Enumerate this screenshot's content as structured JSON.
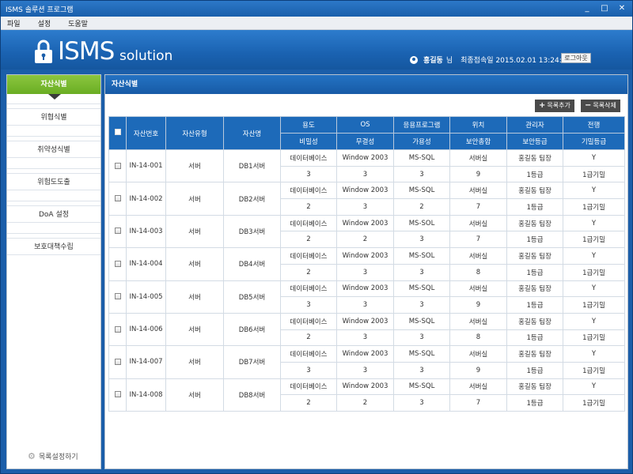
{
  "window": {
    "title": "ISMS 솔루션 프로그램",
    "ctrl_min": "_",
    "ctrl_max": "□",
    "ctrl_close": "✕"
  },
  "menu": [
    "파일",
    "설정",
    "도움말"
  ],
  "header": {
    "logo_main": "ISMS",
    "logo_sub": "solution",
    "user_name": "홍길동",
    "user_suffix": "님",
    "last_login": "최종접속일 2015.02.01 13:24:03",
    "logout": "로그아웃"
  },
  "sidebar": {
    "active": "자산식별",
    "items": [
      "위협식별",
      "취약성식별",
      "위험도도출",
      "DoA 설정",
      "보호대책수립"
    ],
    "settings": "목록설정하기"
  },
  "main": {
    "title": "자산식별",
    "add_button": "목록추가",
    "delete_button": "목록삭제",
    "headers_top": [
      "자산번호",
      "자산유형",
      "자산명",
      "용도",
      "OS",
      "응용프로그램",
      "위치",
      "관리자",
      "전행"
    ],
    "headers_bottom": [
      "비밀성",
      "무결성",
      "가용성",
      "보안총합",
      "보안등급",
      "기밀등급"
    ],
    "rows": [
      {
        "id": "IN-14-001",
        "type": "서버",
        "name": "DB1서버",
        "use": "데이터베이스",
        "os": "Window 2003",
        "app": "MS-SQL",
        "loc": "서버실",
        "mgr": "홍길동 팀장",
        "flag": "Y",
        "conf": "3",
        "integ": "3",
        "avail": "3",
        "total": "9",
        "sec": "1등급",
        "secret": "1급기밀"
      },
      {
        "id": "IN-14-002",
        "type": "서버",
        "name": "DB2서버",
        "use": "데이터베이스",
        "os": "Window 2003",
        "app": "MS-SQL",
        "loc": "서버실",
        "mgr": "홍길동 팀장",
        "flag": "Y",
        "conf": "2",
        "integ": "3",
        "avail": "2",
        "total": "7",
        "sec": "1등급",
        "secret": "1급기밀"
      },
      {
        "id": "IN-14-003",
        "type": "서버",
        "name": "DB3서버",
        "use": "데이터베이스",
        "os": "Window 2003",
        "app": "MS-SOL",
        "loc": "서버실",
        "mgr": "홍길동 팀장",
        "flag": "Y",
        "conf": "2",
        "integ": "2",
        "avail": "3",
        "total": "7",
        "sec": "1등급",
        "secret": "1급기밀"
      },
      {
        "id": "IN-14-004",
        "type": "서버",
        "name": "DB4서버",
        "use": "데이터베이스",
        "os": "Window 2003",
        "app": "MS-SOL",
        "loc": "서버실",
        "mgr": "홍길동 팀장",
        "flag": "Y",
        "conf": "2",
        "integ": "3",
        "avail": "3",
        "total": "8",
        "sec": "1등급",
        "secret": "1급기밀"
      },
      {
        "id": "IN-14-005",
        "type": "서버",
        "name": "DB5서버",
        "use": "데이터베이스",
        "os": "Window 2003",
        "app": "MS-SQL",
        "loc": "서버실",
        "mgr": "홍길동 팀장",
        "flag": "Y",
        "conf": "3",
        "integ": "3",
        "avail": "3",
        "total": "9",
        "sec": "1등급",
        "secret": "1급기밀"
      },
      {
        "id": "IN-14-006",
        "type": "서버",
        "name": "DB6서버",
        "use": "데이터베이스",
        "os": "Window 2003",
        "app": "MS-SQL",
        "loc": "서버실",
        "mgr": "홍길동 팀장",
        "flag": "Y",
        "conf": "2",
        "integ": "3",
        "avail": "3",
        "total": "8",
        "sec": "1등급",
        "secret": "1급기밀"
      },
      {
        "id": "IN-14-007",
        "type": "서버",
        "name": "DB7서버",
        "use": "데이터베이스",
        "os": "Window 2003",
        "app": "MS-SQL",
        "loc": "서버실",
        "mgr": "홍길동 팀장",
        "flag": "Y",
        "conf": "3",
        "integ": "3",
        "avail": "3",
        "total": "9",
        "sec": "1등급",
        "secret": "1급기밀"
      },
      {
        "id": "IN-14-008",
        "type": "서버",
        "name": "DB8서버",
        "use": "데이터베이스",
        "os": "Window 2003",
        "app": "MS-SQL",
        "loc": "서버실",
        "mgr": "홍길동 팀장",
        "flag": "Y",
        "conf": "2",
        "integ": "2",
        "avail": "3",
        "total": "7",
        "sec": "1등급",
        "secret": "1급기밀"
      }
    ]
  },
  "colors": {
    "header_blue": "#1a5fab",
    "active_green": "#7cbb31",
    "table_header": "#1d6ab9"
  }
}
